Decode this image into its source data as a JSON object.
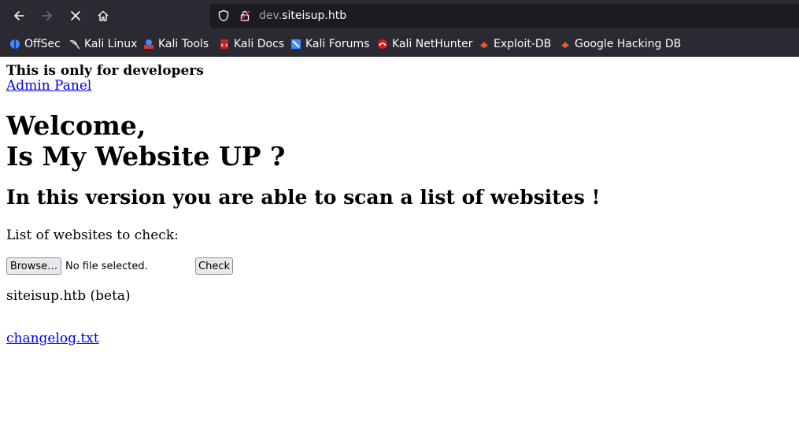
{
  "browser": {
    "url_prefix": "dev.",
    "url_domain": "siteisup.htb",
    "bookmarks": [
      {
        "label": "OffSec",
        "icon": "offsec-icon",
        "color": "#3d8bfd"
      },
      {
        "label": "Kali Linux",
        "icon": "kali-dragon-icon",
        "color": "#e0e0e0"
      },
      {
        "label": "Kali Tools",
        "icon": "kali-tools-icon",
        "color": "#e03030"
      },
      {
        "label": "Kali Docs",
        "icon": "kali-docs-icon",
        "color": "#d02020"
      },
      {
        "label": "Kali Forums",
        "icon": "kali-forums-icon",
        "color": "#3d8bfd"
      },
      {
        "label": "Kali NetHunter",
        "icon": "nethunter-icon",
        "color": "#d02020"
      },
      {
        "label": "Exploit-DB",
        "icon": "exploitdb-icon",
        "color": "#e06020"
      },
      {
        "label": "Google Hacking DB",
        "icon": "ghdb-icon",
        "color": "#e06020"
      }
    ]
  },
  "page": {
    "dev_note": "This is only for developers",
    "admin_link": "Admin Panel",
    "heading_line1": "Welcome,",
    "heading_line2": "Is My Website UP ?",
    "subheading": "In this version you are able to scan a list of websites !",
    "list_label": "List of websites to check:",
    "browse_button": "Browse…",
    "no_file_text": "No file selected.",
    "check_button": "Check",
    "beta_text": "siteisup.htb (beta)",
    "changelog_link": "changelog.txt"
  }
}
